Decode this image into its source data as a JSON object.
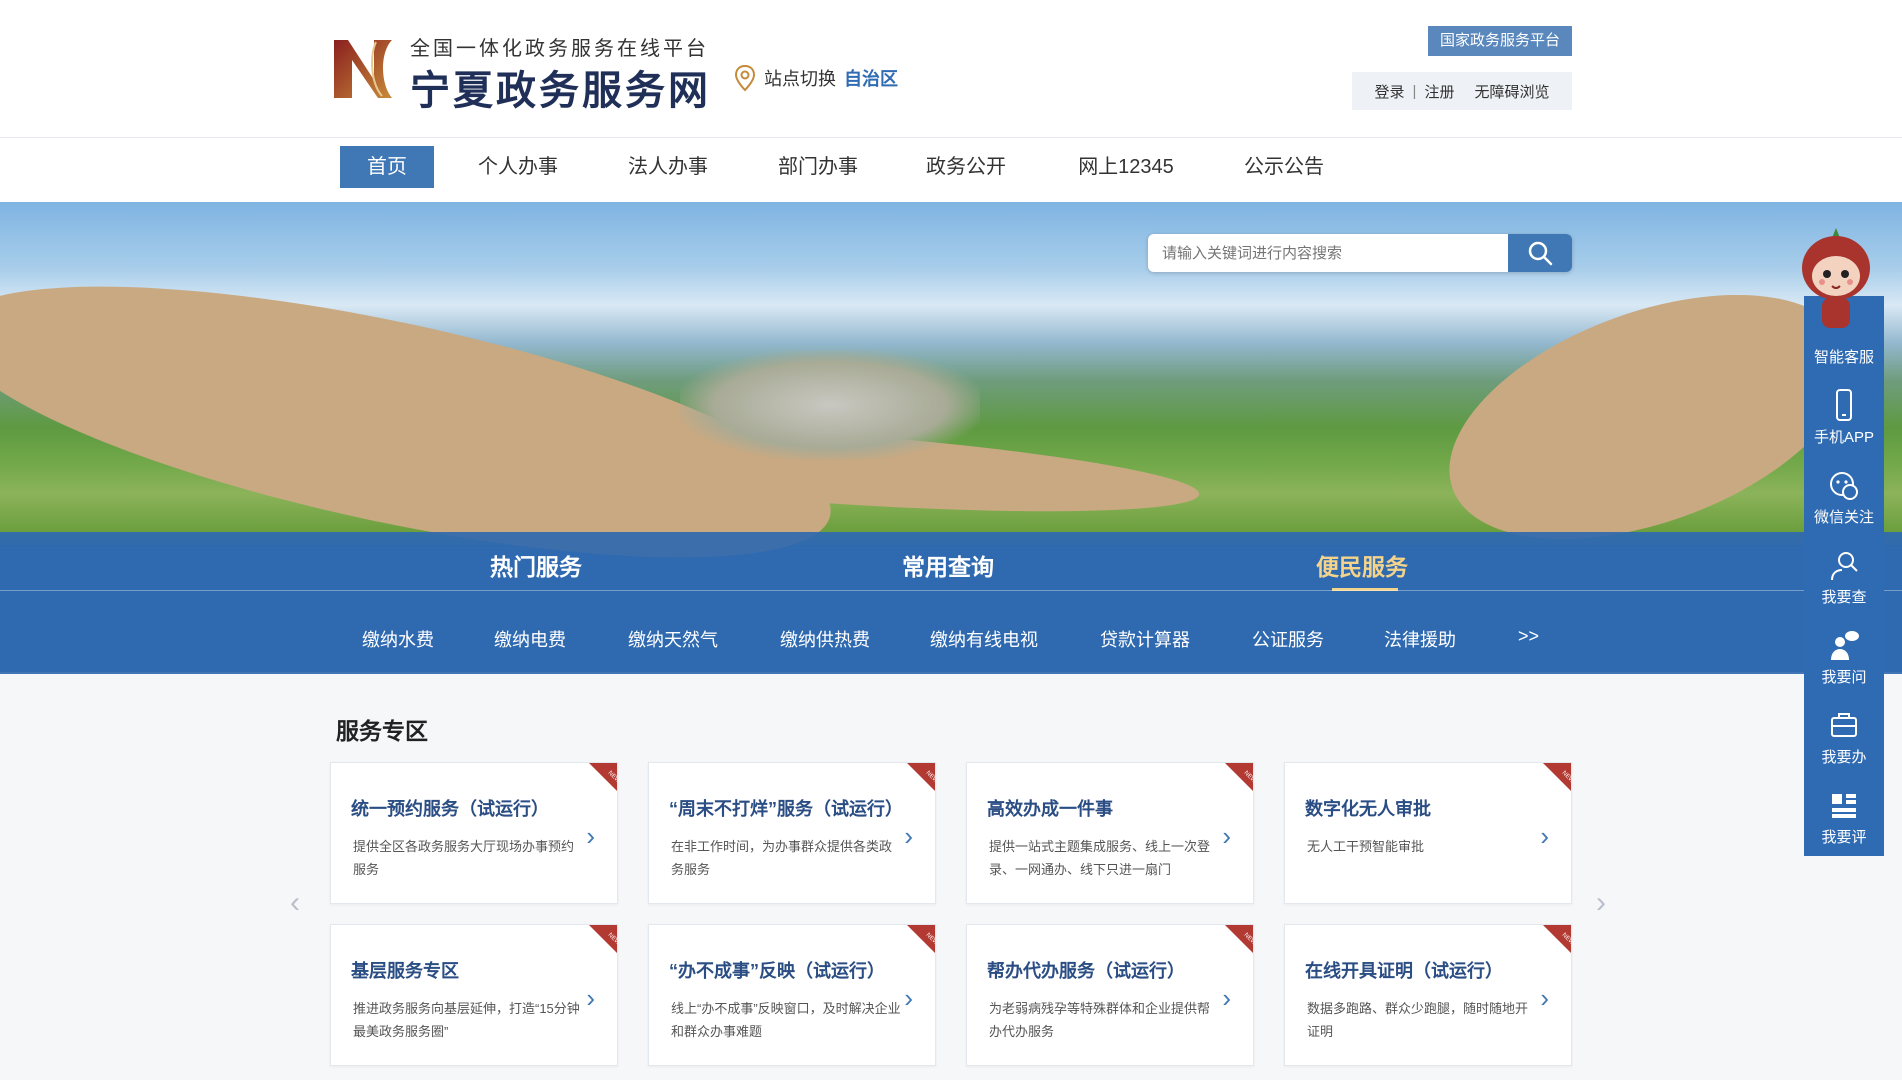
{
  "header": {
    "brand_sub": "全国一体化政务服务在线平台",
    "brand_main": "宁夏政务服务网",
    "site_switch": "站点切换",
    "region": "自治区",
    "national_platform": "国家政务服务平台",
    "login": "登录",
    "separator": "|",
    "register": "注册",
    "accessibility": "无障碍浏览"
  },
  "nav": [
    {
      "label": "首页",
      "active": true
    },
    {
      "label": "个人办事"
    },
    {
      "label": "法人办事"
    },
    {
      "label": "部门办事"
    },
    {
      "label": "政务公开"
    },
    {
      "label": "网上12345"
    },
    {
      "label": "公示公告"
    }
  ],
  "search": {
    "placeholder": "请输入关键词进行内容搜索",
    "icon": "search-icon"
  },
  "band": {
    "tabs": [
      {
        "label": "热门服务"
      },
      {
        "label": "常用查询"
      },
      {
        "label": "便民服务",
        "active": true
      }
    ],
    "items": [
      "缴纳水费",
      "缴纳电费",
      "缴纳天然气",
      "缴纳供热费",
      "缴纳有线电视",
      "贷款计算器",
      "公证服务",
      "法律援助",
      ">>"
    ]
  },
  "section": {
    "title": "服务专区",
    "cards": [
      {
        "title": "统一预约服务（试运行）",
        "desc": "提供全区各政务服务大厅现场办事预约服务",
        "badge": "NEW"
      },
      {
        "title": "“周末不打烊”服务（试运行）",
        "desc": "在非工作时间，为办事群众提供各类政务服务",
        "badge": "NEW"
      },
      {
        "title": "高效办成一件事",
        "desc": "提供一站式主题集成服务、线上一次登录、一网通办、线下只进一扇门",
        "badge": "NEW"
      },
      {
        "title": "数字化无人审批",
        "desc": "无人工干预智能审批",
        "badge": "NEW"
      },
      {
        "title": "基层服务专区",
        "desc": "推进政务服务向基层延伸，打造“15分钟最美政务服务圈”",
        "badge": "NEW"
      },
      {
        "title": "“办不成事”反映（试运行）",
        "desc": "线上“办不成事”反映窗口，及时解决企业和群众办事难题",
        "badge": "NEW"
      },
      {
        "title": "帮办代办服务（试运行）",
        "desc": "为老弱病残孕等特殊群体和企业提供帮办代办服务",
        "badge": "NEW"
      },
      {
        "title": "在线开具证明（试运行）",
        "desc": "数据多跑路、群众少跑腿，随时随地开证明",
        "badge": "NEW"
      }
    ],
    "prev": "‹",
    "next": "›"
  },
  "floatbar": [
    {
      "label": "智能客服",
      "icon": "chat-robot-icon"
    },
    {
      "label": "手机APP",
      "icon": "phone-icon"
    },
    {
      "label": "微信关注",
      "icon": "wechat-icon"
    },
    {
      "label": "我要查",
      "icon": "search-person-icon"
    },
    {
      "label": "我要问",
      "icon": "question-icon"
    },
    {
      "label": "我要办",
      "icon": "briefcase-icon"
    },
    {
      "label": "我要评",
      "icon": "grid-icon"
    }
  ],
  "colors": {
    "primary": "#3f78b5",
    "band": "#3069b0",
    "brand": "#1f2f57",
    "accent": "#f4d48a",
    "badge": "#b23a32"
  }
}
